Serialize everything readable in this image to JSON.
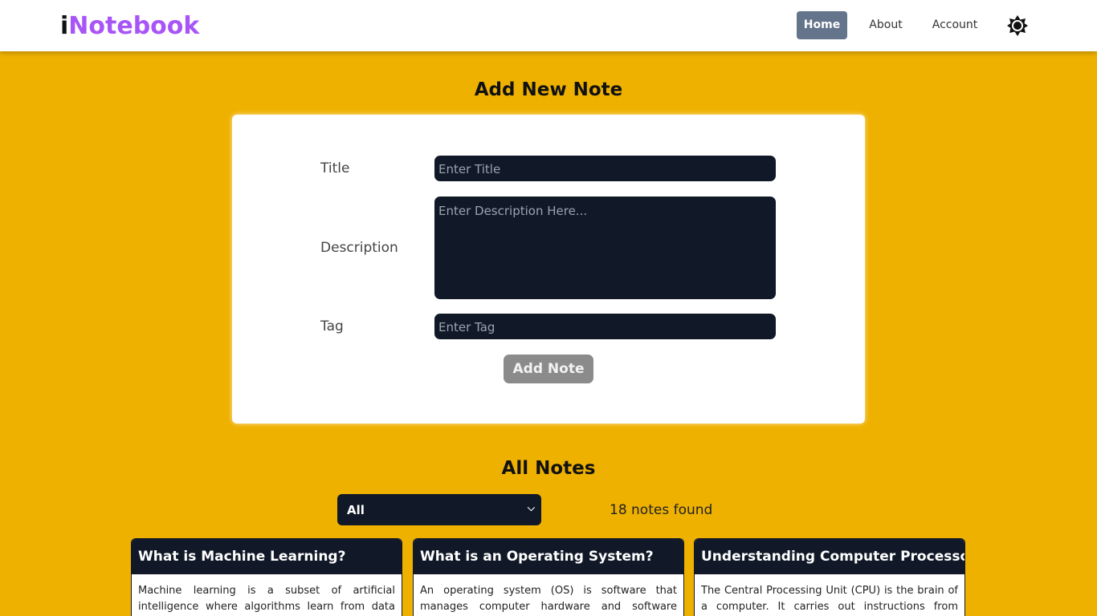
{
  "nav": {
    "brand_first": "i",
    "brand_rest": "Notebook",
    "links": [
      "Home",
      "About",
      "Account"
    ],
    "active_link": "Home",
    "theme_icon": "sun-icon"
  },
  "add_note": {
    "heading": "Add New Note",
    "title_label": "Title",
    "title_placeholder": "Enter Title",
    "description_label": "Description",
    "description_placeholder": "Enter Description Here...",
    "tag_label": "Tag",
    "tag_placeholder": "Enter Tag",
    "submit_label": "Add Note"
  },
  "all_notes": {
    "heading": "All Notes",
    "filter_selected": "All",
    "count_text": "18 notes found",
    "notes": [
      {
        "title": "What is Machine Learning?",
        "description": "Machine learning is a subset of artificial intelligence where algorithms learn from data patterns to make"
      },
      {
        "title": "What is an Operating System?",
        "description": "An operating system (OS) is software that manages computer hardware and software resources. It"
      },
      {
        "title": "Understanding Computer Processors",
        "description": "The Central Processing Unit (CPU) is the brain of a computer. It carries out instructions from programs"
      }
    ]
  },
  "colors": {
    "page_background": "#efb100",
    "brand_accent": "#a855f7",
    "dark": "#111827",
    "active_nav": "#64748b"
  }
}
